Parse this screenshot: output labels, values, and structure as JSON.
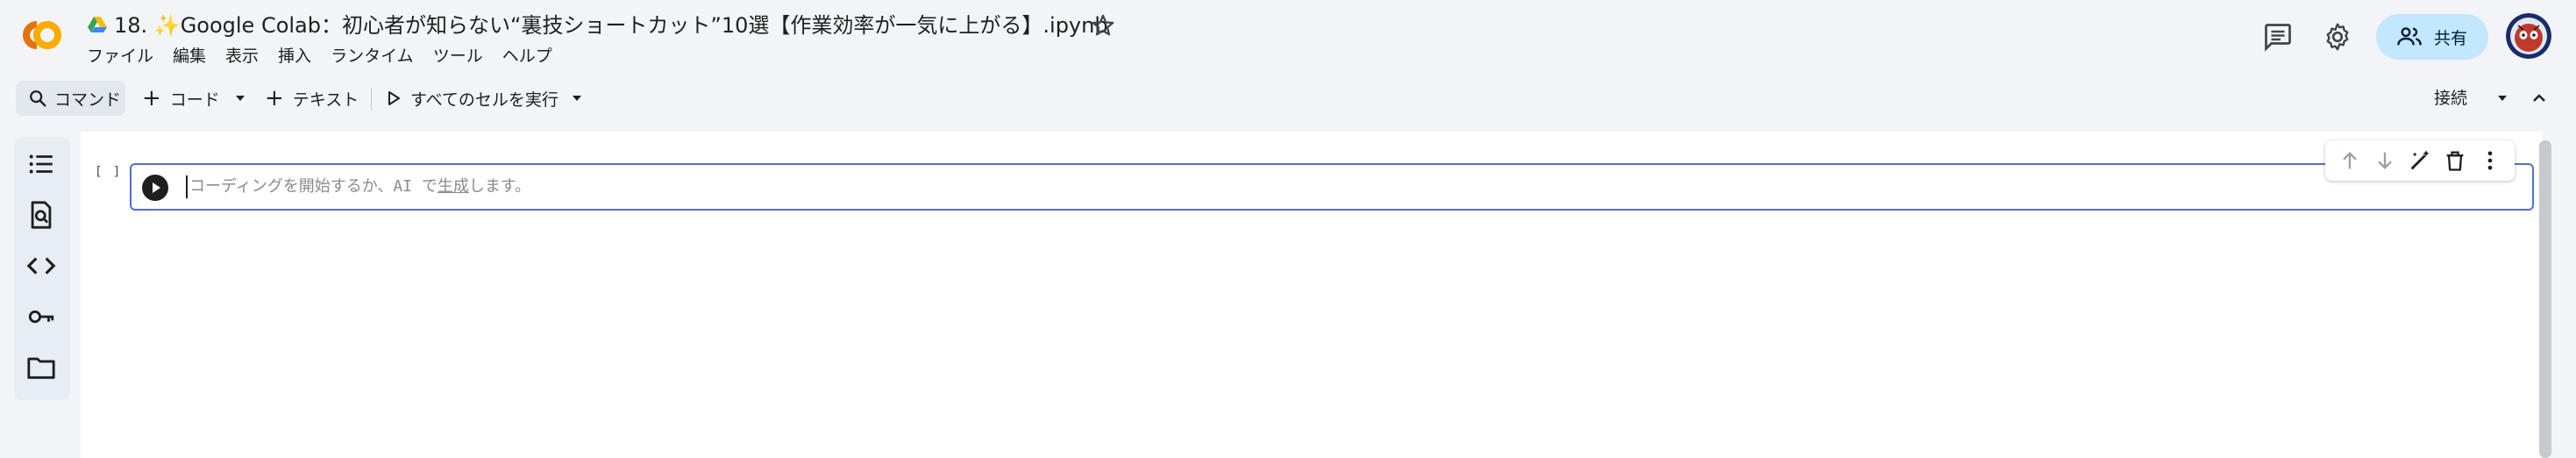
{
  "app": {
    "title_prefix": "18. ",
    "title_sparkle": "✨",
    "title_text": "Google Colab：初心者が知らない“裏技ショートカット”10選【作業効率が一気に上がる】.ipynb",
    "logo_icon": "colab-logo-icon",
    "drive_icon": "google-drive-icon",
    "star_icon": "star-icon"
  },
  "menu": {
    "items": [
      {
        "label": "ファイル"
      },
      {
        "label": "編集"
      },
      {
        "label": "表示"
      },
      {
        "label": "挿入"
      },
      {
        "label": "ランタイム"
      },
      {
        "label": "ツール"
      },
      {
        "label": "ヘルプ"
      }
    ]
  },
  "header_right": {
    "share_label": "共有",
    "comment_icon": "comment-icon",
    "settings_icon": "gear-icon"
  },
  "toolbar": {
    "command_label": "コマンド",
    "code_label": "コード",
    "text_label": "テキスト",
    "run_all_label": "すべてのセルを実行",
    "connect_label": "接続"
  },
  "side_rail": {
    "icons": [
      "table-of-contents-icon",
      "find-replace-icon",
      "code-snippets-icon",
      "secrets-key-icon",
      "files-folder-icon"
    ]
  },
  "cell": {
    "bracket": "[ ]",
    "placeholder_pre": "コーディングを開始するか、AI で",
    "placeholder_link": "生成",
    "placeholder_post": "します。"
  },
  "cell_toolbar": {
    "icons": [
      "move-up-icon",
      "move-down-icon",
      "edit-magic-icon",
      "delete-icon",
      "more-vert-icon"
    ]
  },
  "colors": {
    "accent": "#4f6fd0",
    "share_bg": "#c2e7ff",
    "logo_orange": "#f9ab00",
    "logo_dark_orange": "#e8710a"
  }
}
